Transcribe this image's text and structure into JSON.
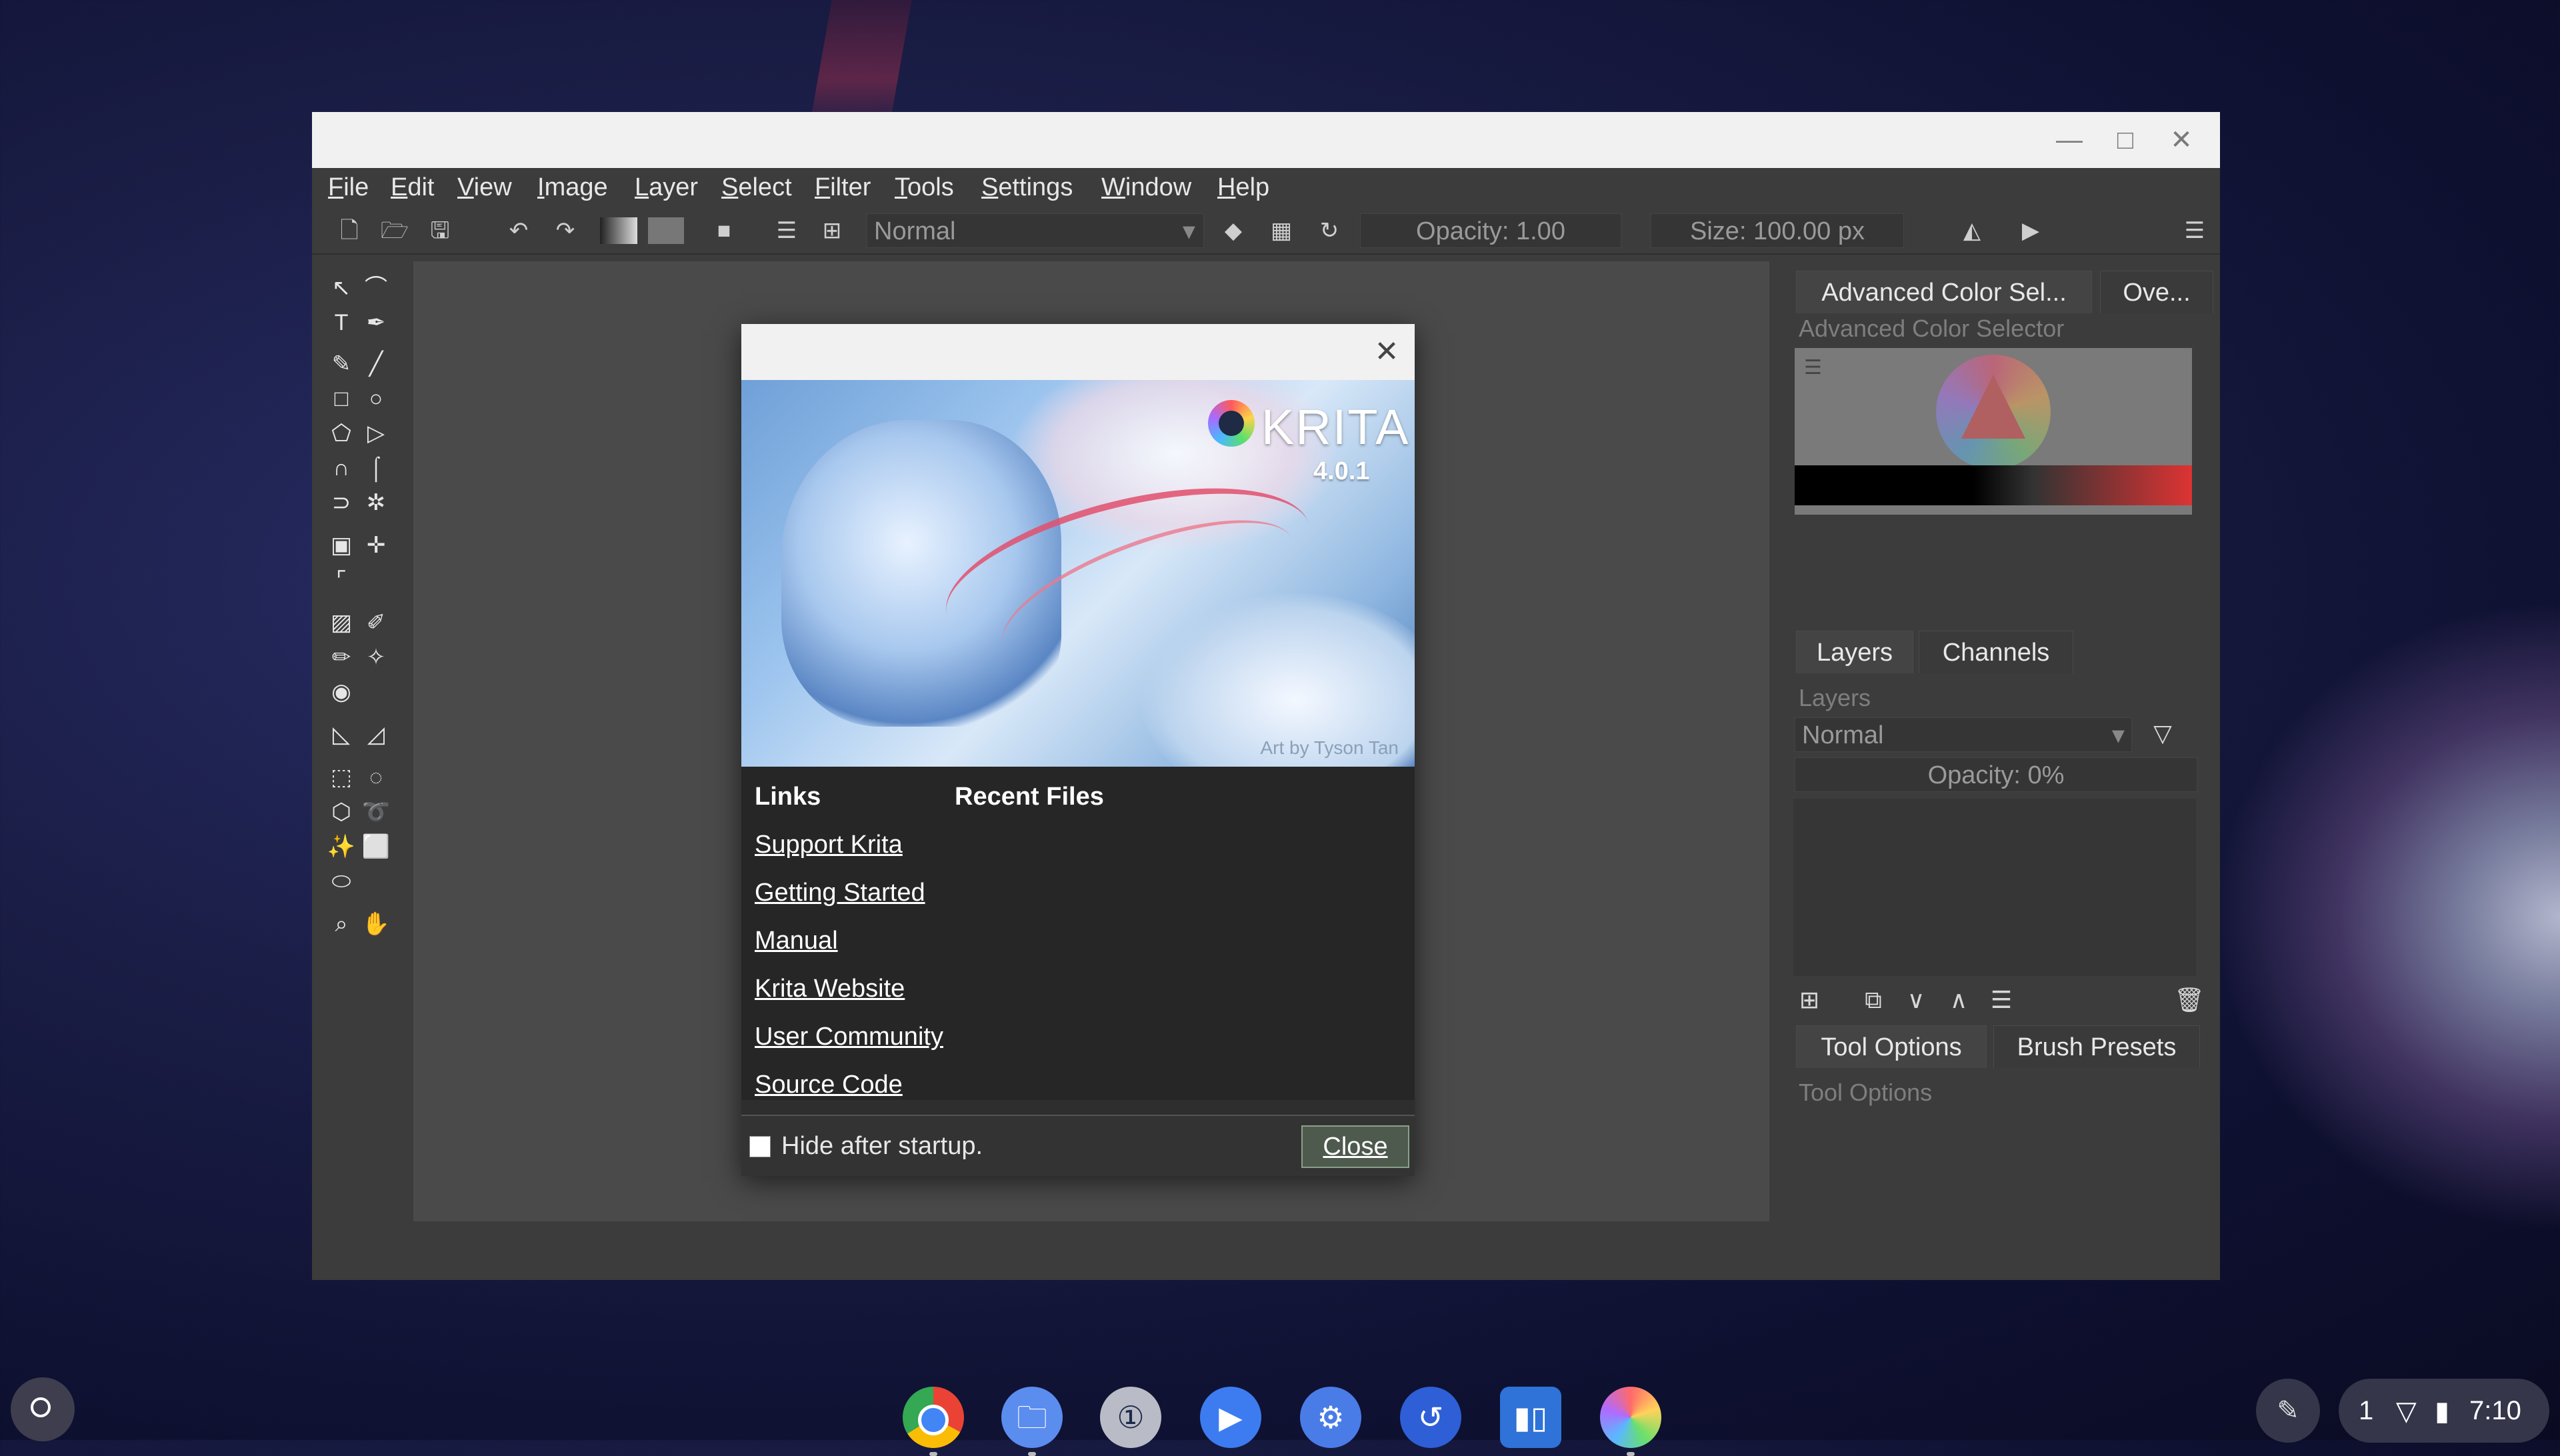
{
  "menubar": [
    "File",
    "Edit",
    "View",
    "Image",
    "Layer",
    "Select",
    "Filter",
    "Tools",
    "Settings",
    "Window",
    "Help"
  ],
  "toolbar": {
    "blend_mode": "Normal",
    "opacity": "Opacity:  1.00",
    "size": "Size:  100.00 px"
  },
  "dock": {
    "color_tab": "Advanced Color Sel...",
    "overview_tab": "Ove...",
    "color_title": "Advanced Color Selector",
    "layers_tab": "Layers",
    "channels_tab": "Channels",
    "layers_title": "Layers",
    "layers_blend": "Normal",
    "layers_opacity": "Opacity:  0%",
    "tool_options_tab": "Tool Options",
    "brush_presets_tab": "Brush Presets",
    "tool_options_title": "Tool Options"
  },
  "dialog": {
    "app_name": "KRITA",
    "version": "4.0.1",
    "art_credit": "Art by Tyson Tan",
    "links_heading": "Links",
    "recent_heading": "Recent Files",
    "links": [
      "Support Krita",
      "Getting Started",
      "Manual",
      "Krita Website",
      "User Community",
      "Source Code"
    ],
    "hide_label": "Hide after startup.",
    "close_label": "Close"
  },
  "shelf": {
    "time": "7:10",
    "notification_count": "1",
    "apps": [
      "chrome",
      "files",
      "1password",
      "duo",
      "settings",
      "app6",
      "trello",
      "krita"
    ]
  }
}
